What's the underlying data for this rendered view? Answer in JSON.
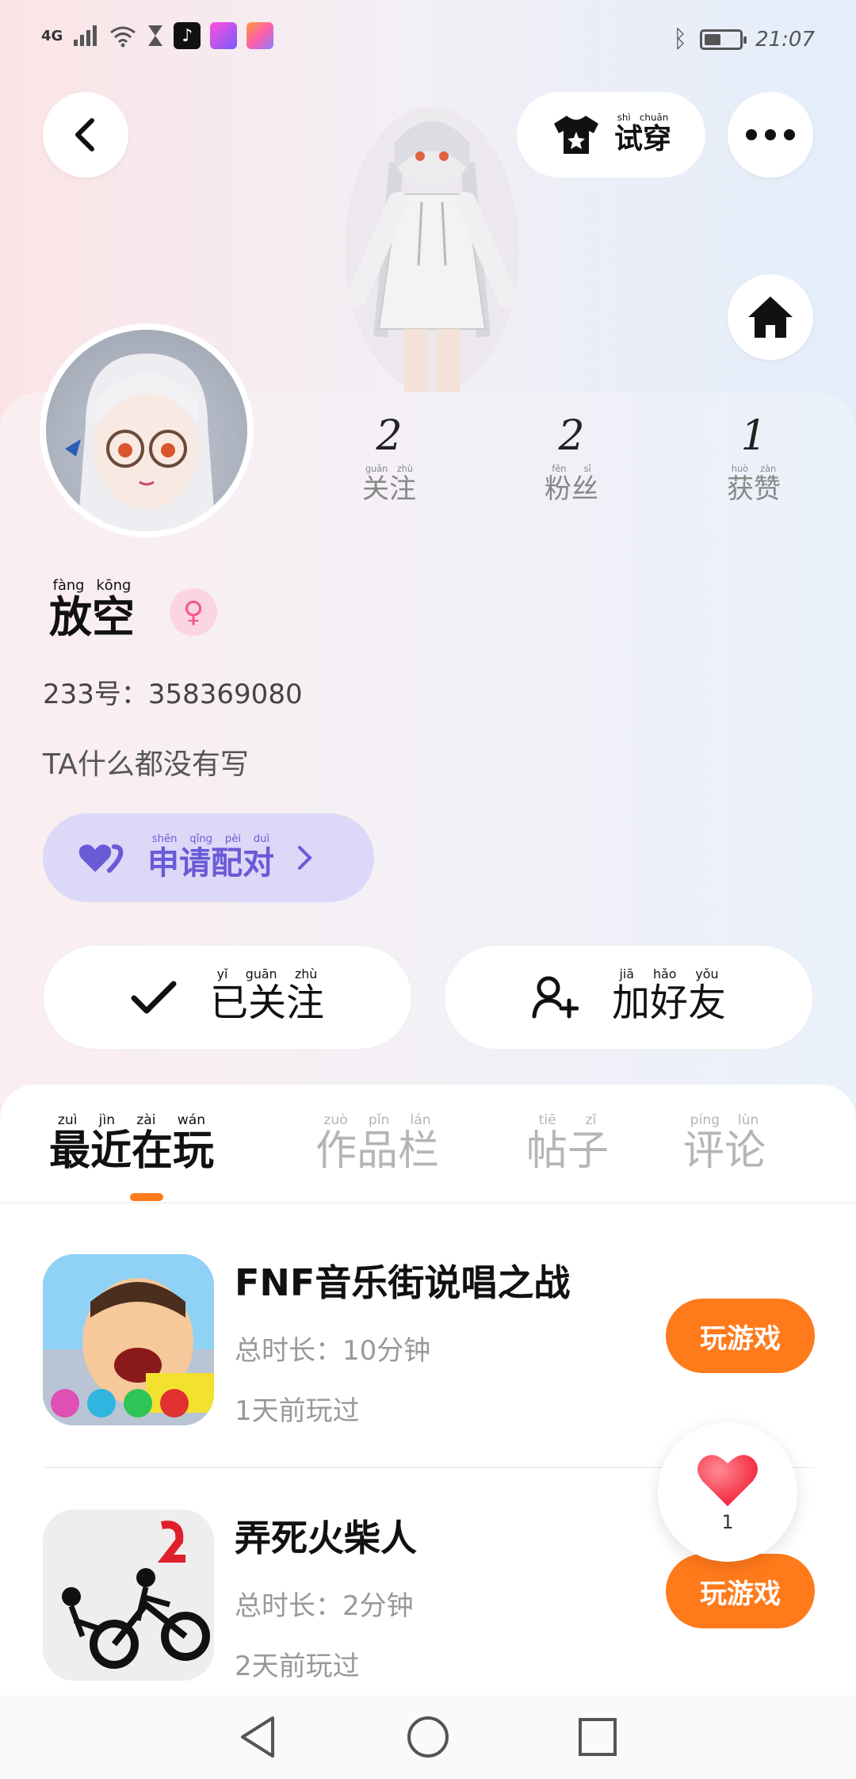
{
  "status_bar": {
    "network": "4G",
    "time": "21:07"
  },
  "header": {
    "try_on_label": "试穿",
    "try_on_pinyin": "shì chuān"
  },
  "profile": {
    "stats": [
      {
        "value": "2",
        "label": "关注",
        "pinyin": "guān zhù"
      },
      {
        "value": "2",
        "label": "粉丝",
        "pinyin": "fěn sī"
      },
      {
        "value": "1",
        "label": "获赞",
        "pinyin": "huò zàn"
      }
    ],
    "name": "放空",
    "name_pinyin": "fàng kōng",
    "gender_icon": "♀",
    "uid_text": "233号：358369080",
    "bio": "TA什么都没有写",
    "pair_button": "申请配对",
    "pair_pinyin": "shēn qǐng pèi duì",
    "follow_button": "已关注",
    "follow_pinyin": "yǐ guān zhù",
    "add_friend_button": "加好友",
    "add_friend_pinyin": "jiā hǎo yǒu"
  },
  "tabs": [
    {
      "label": "最近在玩",
      "pinyin": "zuì jìn zài wán",
      "active": true
    },
    {
      "label": "作品栏",
      "pinyin": "zuò pǐn lán",
      "active": false
    },
    {
      "label": "帖子",
      "pinyin": "tiē zǐ",
      "active": false
    },
    {
      "label": "评论",
      "pinyin": "píng lùn",
      "active": false
    }
  ],
  "games": [
    {
      "title": "FNF音乐街说唱之战",
      "duration": "总时长：10分钟",
      "last_played": "1天前玩过",
      "play_label": "玩游戏"
    },
    {
      "title": "弄死火柴人",
      "duration": "总时长：2分钟",
      "last_played": "2天前玩过",
      "play_label": "玩游戏"
    }
  ],
  "like_fab": {
    "count": "1"
  },
  "colors": {
    "accent_orange": "#ff7a1a",
    "pair_purple": "#6b5ad6",
    "gender_pink": "#f15a8f"
  }
}
